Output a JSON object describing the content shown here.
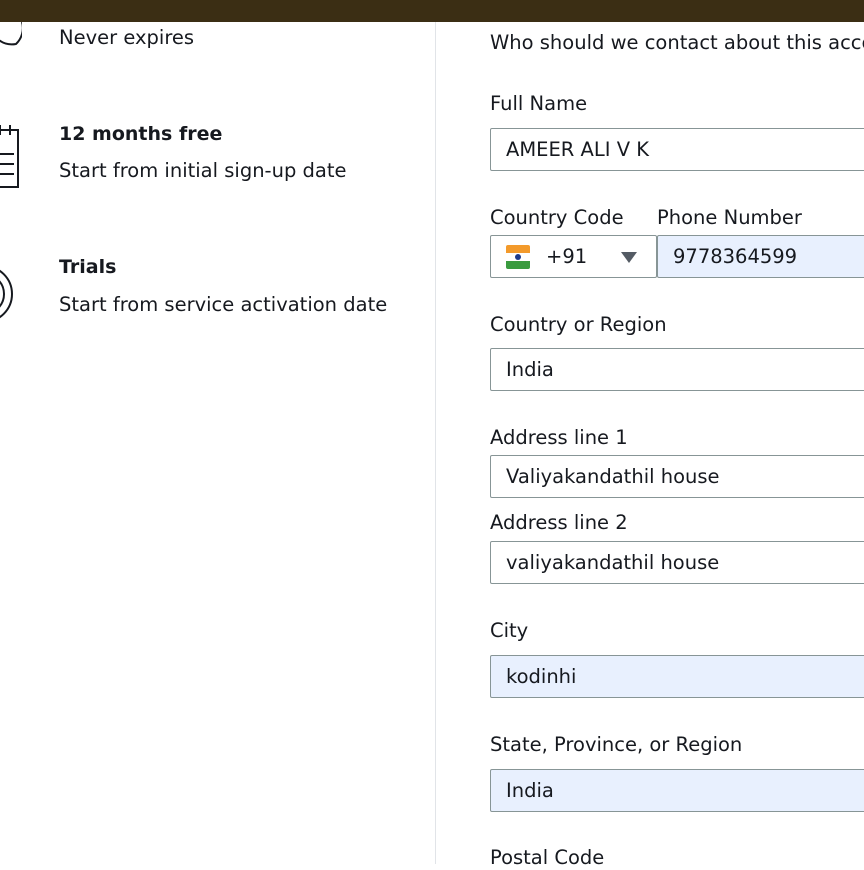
{
  "tiers": [
    {
      "title": "",
      "subtitle": "Never expires",
      "icon": "clock-icon"
    },
    {
      "title": "12 months free",
      "subtitle": "Start from initial sign-up date",
      "icon": "calendar-icon"
    },
    {
      "title": "Trials",
      "subtitle": "Start from service activation date",
      "icon": "target-icon"
    }
  ],
  "form": {
    "question": "Who should we contact about this accou",
    "full_name": {
      "label": "Full Name",
      "value": "AMEER ALI V K"
    },
    "country_code": {
      "label": "Country Code",
      "value": "+91",
      "flag": "india-flag-icon"
    },
    "phone": {
      "label": "Phone Number",
      "value": "9778364599"
    },
    "country": {
      "label": "Country or Region",
      "value": "India"
    },
    "address1": {
      "label": "Address line 1",
      "value": "Valiyakandathil house"
    },
    "address2": {
      "label": "Address line 2",
      "value": "valiyakandathil house"
    },
    "city": {
      "label": "City",
      "value": "kodinhi"
    },
    "state": {
      "label": "State, Province, or Region",
      "value": "India"
    },
    "postal": {
      "label": "Postal Code"
    }
  },
  "colors": {
    "topbar": "#3b2e14",
    "autofill_bg": "#e8f0fe",
    "field_border": "#879596",
    "text": "#16191f"
  }
}
